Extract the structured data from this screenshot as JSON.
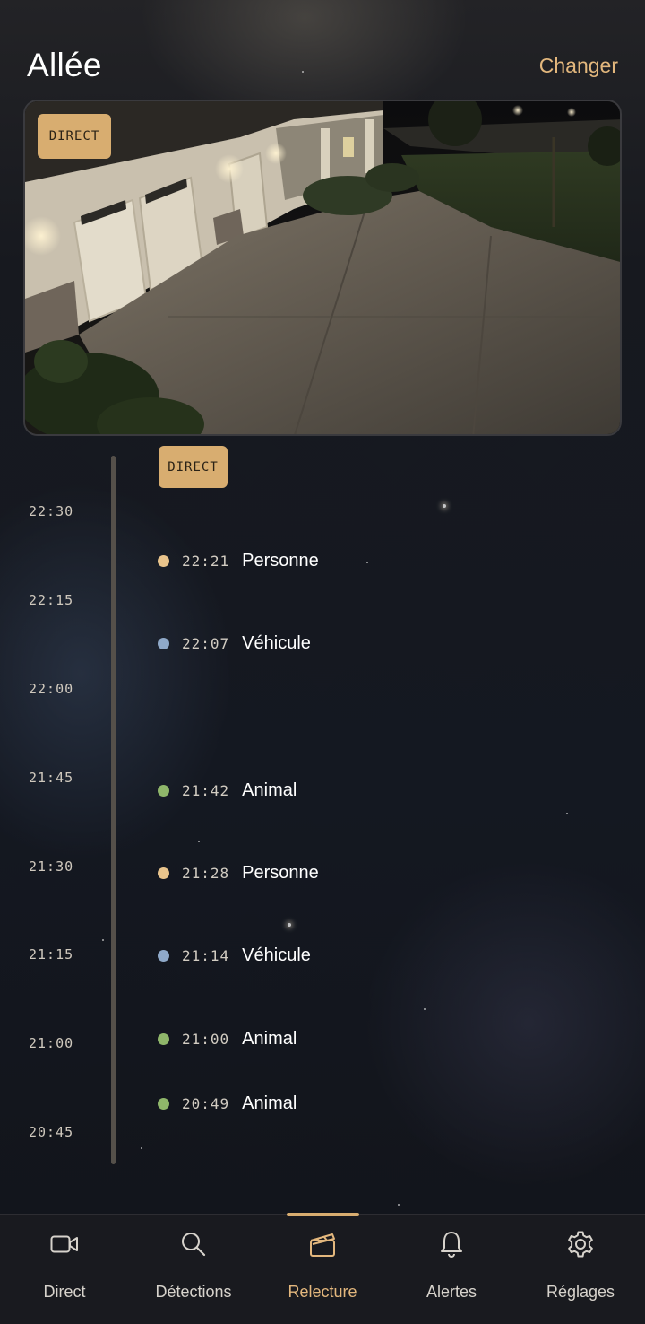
{
  "header": {
    "title": "Allée",
    "change_label": "Changer"
  },
  "video": {
    "badge": "DIRECT"
  },
  "timeline": {
    "badge": "DIRECT",
    "ticks": [
      "22:30",
      "22:15",
      "22:00",
      "21:45",
      "21:30",
      "21:15",
      "21:00",
      "20:45"
    ],
    "events": [
      {
        "time": "22:21",
        "label": "Personne",
        "type": "person",
        "color": "#e9c48c"
      },
      {
        "time": "22:07",
        "label": "Véhicule",
        "type": "vehicle",
        "color": "#8fa9c9"
      },
      {
        "time": "21:42",
        "label": "Animal",
        "type": "animal",
        "color": "#8fb66a"
      },
      {
        "time": "21:28",
        "label": "Personne",
        "type": "person",
        "color": "#e9c48c"
      },
      {
        "time": "21:14",
        "label": "Véhicule",
        "type": "vehicle",
        "color": "#8fa9c9"
      },
      {
        "time": "21:00",
        "label": "Animal",
        "type": "animal",
        "color": "#8fb66a"
      },
      {
        "time": "20:49",
        "label": "Animal",
        "type": "animal",
        "color": "#8fb66a"
      }
    ]
  },
  "tabs": [
    {
      "label": "Direct",
      "icon": "video-camera-icon",
      "active": false
    },
    {
      "label": "Détections",
      "icon": "search-icon",
      "active": false
    },
    {
      "label": "Relecture",
      "icon": "clapperboard-icon",
      "active": true
    },
    {
      "label": "Alertes",
      "icon": "bell-icon",
      "active": false
    },
    {
      "label": "Réglages",
      "icon": "gear-icon",
      "active": false
    }
  ],
  "colors": {
    "accent": "#e3b77d",
    "badge": "#d8ad70",
    "person": "#e9c48c",
    "vehicle": "#8fa9c9",
    "animal": "#8fb66a"
  }
}
